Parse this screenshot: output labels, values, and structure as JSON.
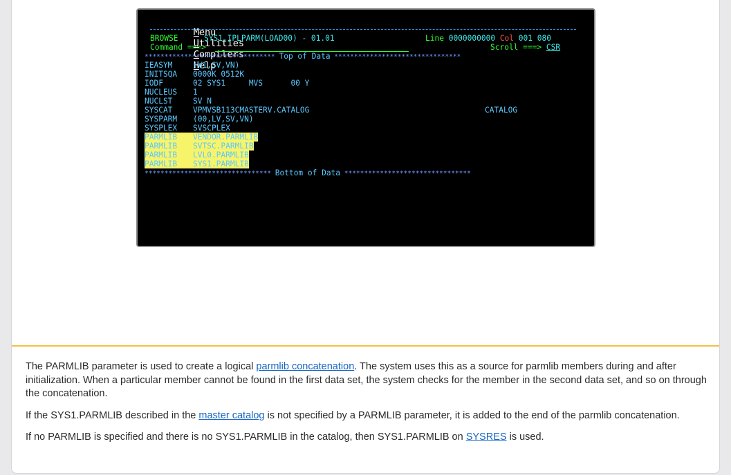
{
  "terminal": {
    "menu": [
      {
        "acc": "M",
        "rest": "enu"
      },
      {
        "acc": "U",
        "rest": "tilities"
      },
      {
        "acc": "C",
        "rest": "ompilers"
      },
      {
        "acc": "H",
        "rest": "elp"
      }
    ],
    "browse_label": "BROWSE",
    "dataset": "SYS1.IPLPARM(LOAD00) - 01.01",
    "line_label": "Line",
    "line_value": "0000000000",
    "col_label": "Col",
    "col_value": "001 080",
    "command_label": "Command ===>",
    "scroll_label": "Scroll ===>",
    "scroll_value": "CSR",
    "top_marker": "Top of Data",
    "bottom_marker": "Bottom of Data",
    "rows": [
      {
        "key": "IEASYM",
        "value": "(W1,SV,VN)",
        "extra": "",
        "highlight": false
      },
      {
        "key": "INITSQA",
        "value": "0000K 0512K",
        "extra": "",
        "highlight": false
      },
      {
        "key": "IODF",
        "value": "02 SYS1     MVS      00 Y",
        "extra": "",
        "highlight": false
      },
      {
        "key": "NUCLEUS",
        "value": "1",
        "extra": "",
        "highlight": false
      },
      {
        "key": "NUCLST",
        "value": "SV N",
        "extra": "",
        "highlight": false
      },
      {
        "key": "SYSCAT",
        "value": "VPMVSB113CMASTERV.CATALOG",
        "extra": "CATALOG",
        "highlight": false
      },
      {
        "key": "SYSPARM",
        "value": "(00,LV,SV,VN)",
        "extra": "",
        "highlight": false
      },
      {
        "key": "SYSPLEX",
        "value": "SVSCPLEX",
        "extra": "",
        "highlight": false
      },
      {
        "key": "PARMLIB",
        "value": "VENDOR.PARMLIB",
        "extra": "",
        "highlight": true
      },
      {
        "key": "PARMLIB",
        "value": "SVTSC.PARMLIB",
        "extra": "",
        "highlight": true
      },
      {
        "key": "PARMLIB",
        "value": "LVL0.PARMLIB",
        "extra": "",
        "highlight": true
      },
      {
        "key": "PARMLIB",
        "value": "SYS1.PARMLIB",
        "extra": "",
        "highlight": true
      }
    ]
  },
  "article": {
    "p1_a": "The PARMLIB parameter is used to create a logical ",
    "p1_link": "parmlib concatenation",
    "p1_b": ". The system uses this as a source for parmlib members during and after initialization. When a particular member cannot be found in the first data set, the system checks for the member in the second data set, and so on through the concatenation.",
    "p2_a": "If the SYS1.PARMLIB described in the ",
    "p2_link": "master catalog",
    "p2_b": " is not specified by a PARMLIB parameter, it is added to the end of the parmlib concatenation.",
    "p3_a": "If no PARMLIB is specified and there is no SYS1.PARMLIB in the catalog, then SYS1.PARMLIB on ",
    "p3_link": "SYSRES",
    "p3_b": " is used."
  }
}
